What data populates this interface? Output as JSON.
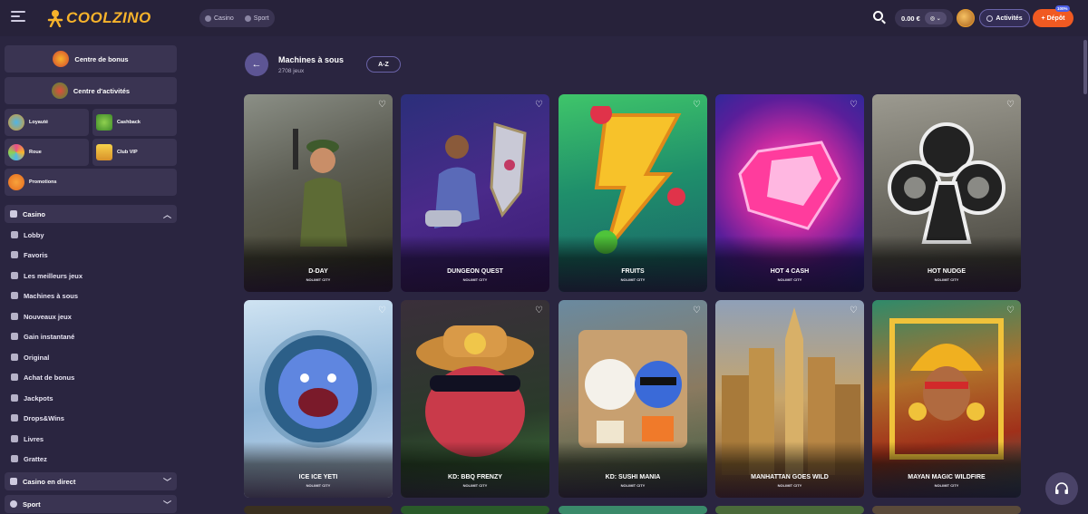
{
  "header": {
    "logo_text": "COOLZINO",
    "tabs": [
      {
        "label": "Casino"
      },
      {
        "label": "Sport"
      }
    ],
    "balance": "0.00 €",
    "activity_label": "Activités",
    "deposit_label": "Dépôt",
    "deposit_badge": "100%"
  },
  "sidebar": {
    "bonus_centre": "Centre de bonus",
    "activity_centre": "Centre d'activités",
    "tiles": [
      "Loyauté",
      "Cashback",
      "Roue",
      "Club VIP",
      "Promotions"
    ],
    "casino_section": "Casino",
    "items": [
      "Lobby",
      "Favoris",
      "Les meilleurs jeux",
      "Machines à sous",
      "Nouveaux jeux",
      "Gain instantané",
      "Original",
      "Achat de bonus",
      "Jackpots",
      "Drops&Wins",
      "Livres",
      "Grattez"
    ],
    "live_section": "Casino en direct",
    "sport_section": "Sport"
  },
  "main": {
    "title": "Machines à sous",
    "count": "2708 jeux",
    "sort_label": "A-Z",
    "games": [
      {
        "name": "D-DAY",
        "provider": "NOLIMIT CITY"
      },
      {
        "name": "DUNGEON QUEST",
        "provider": "NOLIMIT CITY"
      },
      {
        "name": "FRUITS",
        "provider": "NOLIMIT CITY"
      },
      {
        "name": "HOT 4 CASH",
        "provider": "NOLIMIT CITY"
      },
      {
        "name": "HOT NUDGE",
        "provider": "NOLIMIT CITY"
      },
      {
        "name": "ICE ICE YETI",
        "provider": "NOLIMIT CITY"
      },
      {
        "name": "KD: BBQ FRENZY",
        "provider": "NOLIMIT CITY"
      },
      {
        "name": "KD: SUSHI MANIA",
        "provider": "NOLIMIT CITY"
      },
      {
        "name": "MANHATTAN GOES WILD",
        "provider": "NOLIMIT CITY"
      },
      {
        "name": "MAYAN MAGIC WILDFIRE",
        "provider": "NOLIMIT CITY"
      }
    ]
  },
  "colors": {
    "background": "#2a2540",
    "panel": "#3a3452",
    "accent": "#f05a22",
    "brand": "#f7b32b",
    "button_purple": "#5d5594"
  }
}
